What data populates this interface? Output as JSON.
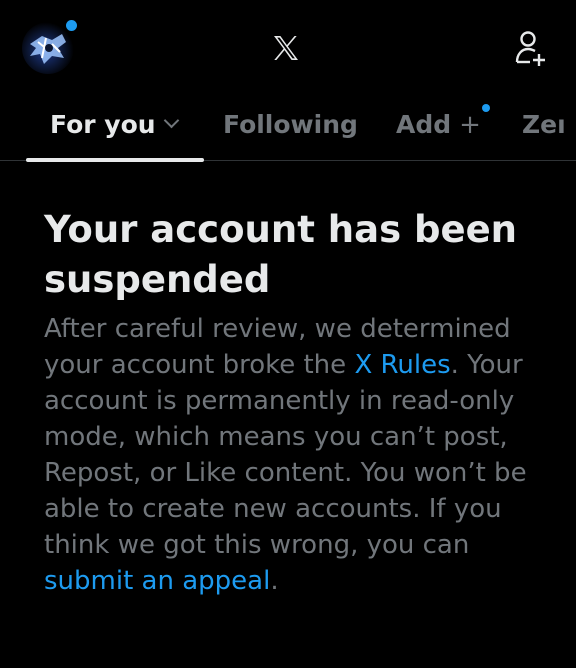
{
  "header": {
    "logo_icon": "x-logo-icon",
    "avatar_icon": "avatar",
    "add_user_icon": "add-user-icon",
    "notification_dot_color": "#1d9bf0"
  },
  "tabs": [
    {
      "label": "For you",
      "active": true
    },
    {
      "label": "Following",
      "active": false
    },
    {
      "label": "Add",
      "icon": "+",
      "active": false
    },
    {
      "label": "Zeı",
      "active": false
    }
  ],
  "notice": {
    "title": "Your account has been suspended",
    "body_part1": "After careful review, we determined your account broke the ",
    "rules_link": "X Rules",
    "body_part2": ". Your account is permanently in read-only mode, which means you can’t post, Repost, or Like content. You won’t be able to create new accounts. If you think we got this wrong, you can ",
    "appeal_link": "submit an appeal",
    "body_end": "."
  },
  "colors": {
    "background": "#000000",
    "primary_text": "#e7e9ea",
    "secondary_text": "#71767b",
    "link": "#1d9bf0"
  }
}
